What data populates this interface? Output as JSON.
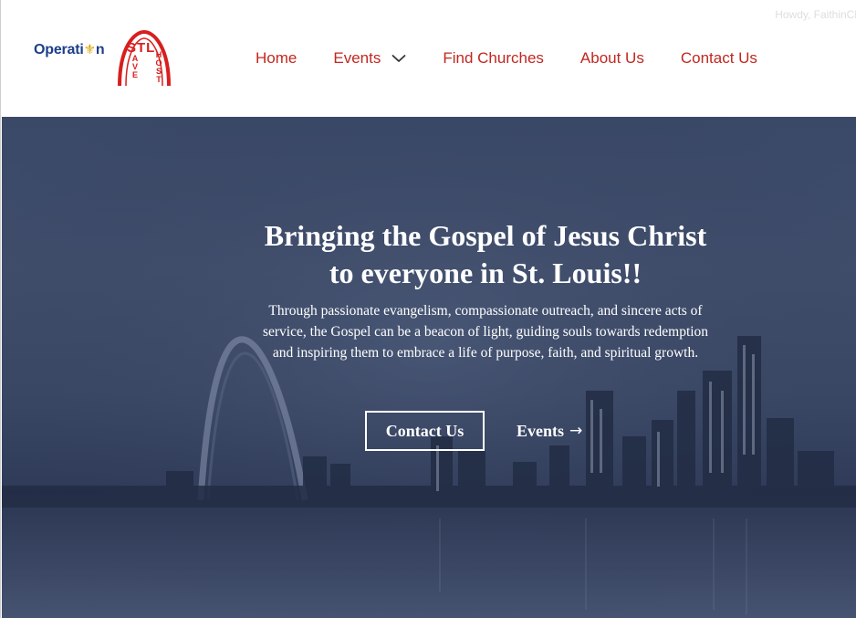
{
  "account": {
    "greeting": "Howdy, FaithinCl"
  },
  "logo": {
    "word": "Operati",
    "word_tail": "n",
    "city": "STL",
    "letters_left": [
      "A",
      "V",
      "E"
    ],
    "letters_right": [
      "H",
      "O",
      "S",
      "T"
    ],
    "icon": "fleur-de-lis-icon"
  },
  "nav": {
    "items": [
      {
        "label": "Home"
      },
      {
        "label": "Events",
        "icon": "chevron-down-icon"
      },
      {
        "label": "Find Churches"
      },
      {
        "label": "About Us"
      },
      {
        "label": "Contact Us"
      }
    ]
  },
  "hero": {
    "title_line1": "Bringing the Gospel of Jesus Christ",
    "title_line2": "to everyone in St. Louis!!",
    "subtitle": "Through passionate evangelism, compassionate outreach, and sincere acts of service, the Gospel can be a beacon of light, guiding souls towards redemption and inspiring them to embrace a life of purpose, faith, and spiritual growth.",
    "primary_button": "Contact Us",
    "secondary_button": "Events",
    "secondary_arrow": "→"
  },
  "colors": {
    "nav_text": "#c02820",
    "logo_blue": "#1d3f8a",
    "logo_red": "#d81e1e",
    "hero_overlay": "#3b4969"
  }
}
